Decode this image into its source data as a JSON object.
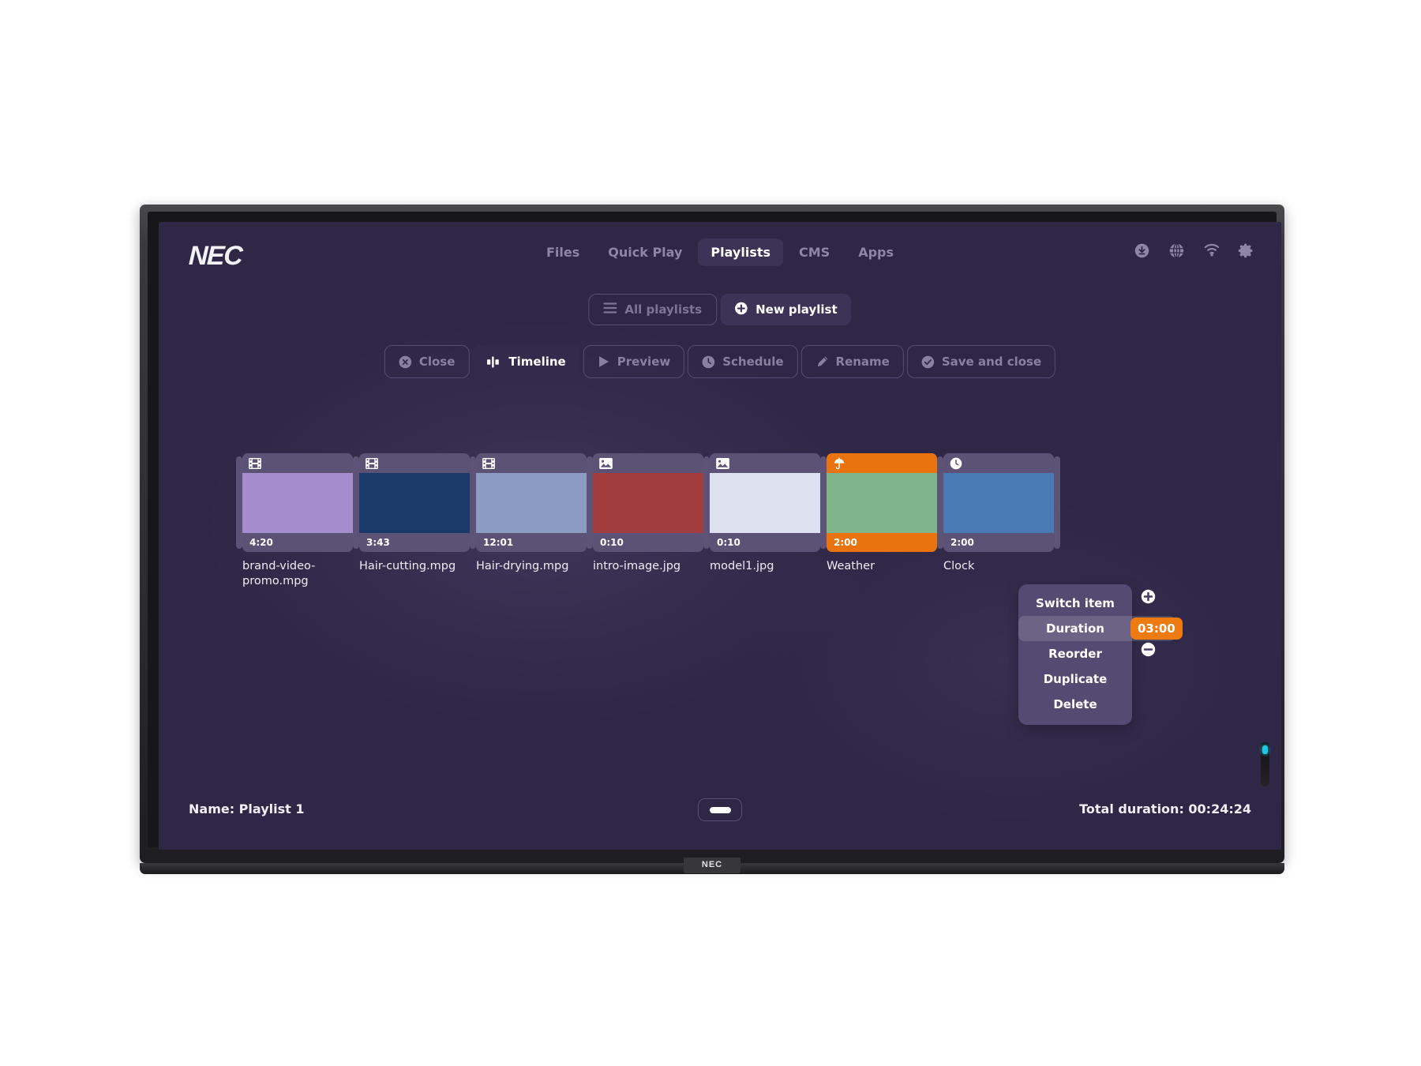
{
  "brand": {
    "logo_text": "NEC",
    "bezel_logo": "NEC"
  },
  "nav": {
    "items": [
      {
        "label": "Files",
        "active": false,
        "name": "nav-files"
      },
      {
        "label": "Quick Play",
        "active": false,
        "name": "nav-quick-play"
      },
      {
        "label": "Playlists",
        "active": true,
        "name": "nav-playlists"
      },
      {
        "label": "CMS",
        "active": false,
        "name": "nav-cms"
      },
      {
        "label": "Apps",
        "active": false,
        "name": "nav-apps"
      }
    ]
  },
  "status_icons": [
    {
      "icon": "download-circle-icon",
      "name": "download-status-icon"
    },
    {
      "icon": "globe-icon",
      "name": "network-globe-icon"
    },
    {
      "icon": "wifi-icon",
      "name": "wifi-icon"
    },
    {
      "icon": "gear-icon",
      "name": "settings-gear-icon"
    }
  ],
  "playlist_bar": {
    "all_playlists_label": "All playlists",
    "all_playlists_icon": "hamburger-icon",
    "new_playlist_label": "New playlist",
    "new_playlist_icon": "plus-circle-icon"
  },
  "toolbar": {
    "buttons": [
      {
        "label": "Close",
        "icon": "close-circle-icon",
        "active": false,
        "name": "close-button"
      },
      {
        "label": "Timeline",
        "icon": "timeline-icon",
        "active": true,
        "name": "timeline-button"
      },
      {
        "label": "Preview",
        "icon": "play-icon",
        "active": false,
        "name": "preview-button"
      },
      {
        "label": "Schedule",
        "icon": "clock-icon",
        "active": false,
        "name": "schedule-button"
      },
      {
        "label": "Rename",
        "icon": "pencil-icon",
        "active": false,
        "name": "rename-button"
      },
      {
        "label": "Save and close",
        "icon": "check-circle-icon",
        "active": false,
        "name": "save-and-close-button"
      }
    ]
  },
  "timeline": {
    "items": [
      {
        "label": "brand-video-promo.mpg",
        "duration": "4:20",
        "icon": "film-icon",
        "color": "#a48ccd",
        "selected": false
      },
      {
        "label": "Hair-cutting.mpg",
        "duration": "3:43",
        "icon": "film-icon",
        "color": "#1b3a6b",
        "selected": false
      },
      {
        "label": "Hair-drying.mpg",
        "duration": "12:01",
        "icon": "film-icon",
        "color": "#8b9bc2",
        "selected": false
      },
      {
        "label": "intro-image.jpg",
        "duration": "0:10",
        "icon": "image-icon",
        "color": "#a33c3c",
        "selected": false
      },
      {
        "label": "model1.jpg",
        "duration": "0:10",
        "icon": "image-icon",
        "color": "#dde1f0",
        "selected": false
      },
      {
        "label": "Weather",
        "duration": "2:00",
        "icon": "umbrella-icon",
        "color": "#82b48b",
        "selected": true
      },
      {
        "label": "Clock",
        "duration": "2:00",
        "icon": "clock-icon",
        "color": "#4a7ab4",
        "selected": false
      }
    ]
  },
  "context_menu": {
    "items": [
      {
        "label": "Switch item",
        "name": "ctx-switch-item"
      },
      {
        "label": "Duration",
        "name": "ctx-duration",
        "highlight": true
      },
      {
        "label": "Reorder",
        "name": "ctx-reorder"
      },
      {
        "label": "Duplicate",
        "name": "ctx-duplicate"
      },
      {
        "label": "Delete",
        "name": "ctx-delete"
      }
    ],
    "duration_value": "03:00",
    "increase_icon": "plus-circle-icon",
    "decrease_icon": "minus-circle-icon"
  },
  "footer": {
    "name_label": "Name: Playlist 1",
    "total_duration_label": "Total duration: 00:24:24",
    "collapse_icon": "minimize-bar-icon"
  },
  "colors": {
    "screen_bg": "#2e2745",
    "accent_orange": "#ee7a12",
    "panel": "#554b72",
    "active_tab": "#3c3356",
    "muted_text": "#8d86a5",
    "led": "#1fc8e0"
  }
}
